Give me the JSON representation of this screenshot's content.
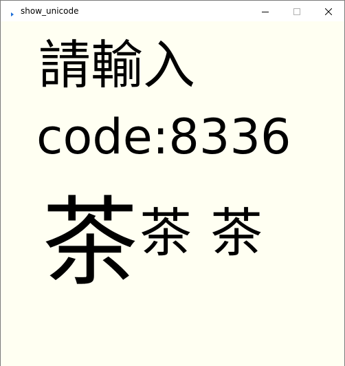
{
  "window": {
    "title": "show_unicode"
  },
  "icons": {
    "app": "app-icon",
    "minimize": "minimize-icon",
    "maximize": "maximize-icon",
    "close": "close-icon"
  },
  "content": {
    "prompt": "請輸入",
    "code_line": "code:8336",
    "glyph_large": "茶",
    "glyph_medium_1": "茶",
    "glyph_medium_2": "茶"
  },
  "colors": {
    "canvas_background": "#fffff2",
    "text": "#000000",
    "app_icon_accent": "#1e6fd9"
  }
}
